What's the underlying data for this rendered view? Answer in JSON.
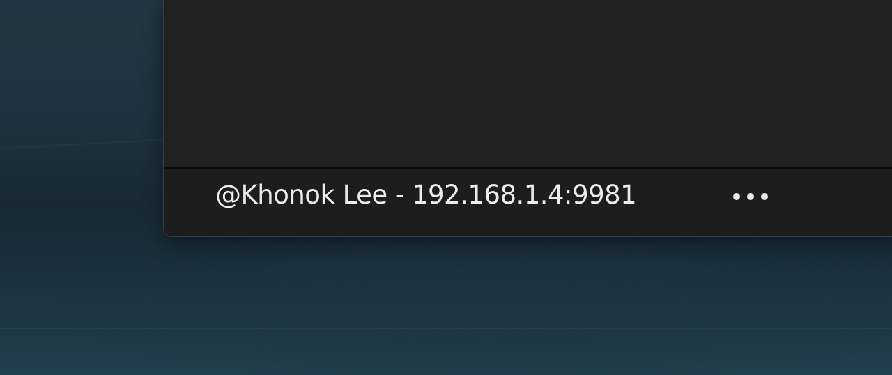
{
  "status_bar": {
    "connection_text": "@Khonok Lee - 192.168.1.4:9981",
    "more_icon": "ellipsis-icon"
  },
  "colors": {
    "window_background": "#202020",
    "status_bar_background": "#1d1d1d",
    "text": "#ececec",
    "desktop": "#1d3240"
  }
}
